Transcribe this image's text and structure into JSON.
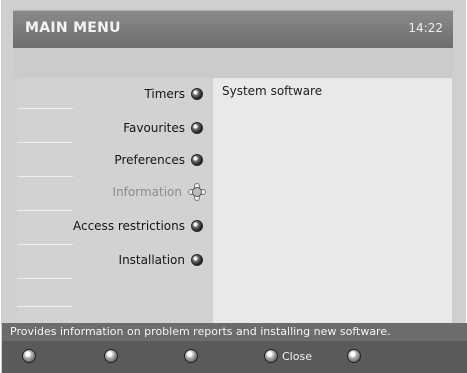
{
  "header": {
    "title": "MAIN MENU",
    "clock": "14:22"
  },
  "menu": {
    "items": [
      {
        "label": "Timers",
        "selected": false
      },
      {
        "label": "Favourites",
        "selected": false
      },
      {
        "label": "Preferences",
        "selected": false
      },
      {
        "label": "Information",
        "selected": true
      },
      {
        "label": "Access restrictions",
        "selected": false
      },
      {
        "label": "Installation",
        "selected": false
      }
    ]
  },
  "detail": {
    "text": "System software"
  },
  "status": {
    "text": "Provides information on problem reports and installing new software."
  },
  "controls": {
    "buttons": [
      {
        "label": ""
      },
      {
        "label": ""
      },
      {
        "label": ""
      },
      {
        "label": "Close"
      },
      {
        "label": ""
      }
    ]
  },
  "colors": {
    "title_bar": "#6e6e6e",
    "status_bar": "#6c6c6c",
    "button_bar": "#5a5a5a",
    "panel": "#e9e9e9",
    "menu_column": "#d2d2d2"
  }
}
